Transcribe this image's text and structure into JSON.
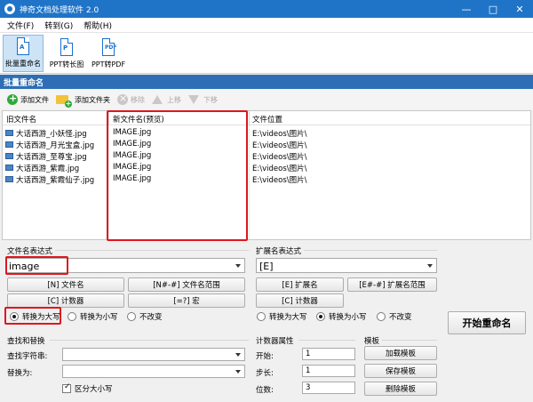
{
  "window": {
    "title": "神奇文档处理软件 2.0"
  },
  "menu": [
    "文件(F)",
    "转到(G)",
    "帮助(H)"
  ],
  "toolbar": {
    "tools": [
      {
        "label": "批量重命名",
        "icon": "rename-icon"
      },
      {
        "label": "PPT转长图",
        "icon": "ppt-icon"
      },
      {
        "label": "PPT转PDF",
        "icon": "pdf-icon"
      }
    ]
  },
  "section_title": "批量重命名",
  "actions": {
    "add_file": "添加文件",
    "add_folder": "添加文件夹",
    "remove": "移除",
    "move_up": "上移",
    "move_down": "下移"
  },
  "table": {
    "headers": {
      "old": "旧文件名",
      "new": "新文件名(预览)",
      "location": "文件位置"
    },
    "rows": [
      {
        "old": "大话西游_小妖怪.jpg",
        "new": "IMAGE.jpg",
        "location": "E:\\videos\\图片\\"
      },
      {
        "old": "大话西游_月光宝盒.jpg",
        "new": "IMAGE.jpg",
        "location": "E:\\videos\\图片\\"
      },
      {
        "old": "大话西游_至尊宝.jpg",
        "new": "IMAGE.jpg",
        "location": "E:\\videos\\图片\\"
      },
      {
        "old": "大话西游_紫霞.jpg",
        "new": "IMAGE.jpg",
        "location": "E:\\videos\\图片\\"
      },
      {
        "old": "大话西游_紫霞仙子.jpg",
        "new": "IMAGE.jpg",
        "location": "E:\\videos\\图片\\"
      }
    ]
  },
  "filename_expr": {
    "label": "文件名表达式",
    "value": "image",
    "buttons": {
      "name": "[N] 文件名",
      "range": "[N#-#] 文件名范围",
      "counter": "[C] 计数器",
      "macro": "[=?] 宏"
    },
    "case": {
      "upper": "转换为大写",
      "lower": "转换为小写",
      "none": "不改变",
      "selected": "upper"
    }
  },
  "ext_expr": {
    "label": "扩展名表达式",
    "value": "[E]",
    "buttons": {
      "ext": "[E] 扩展名",
      "range": "[E#-#] 扩展名范围",
      "counter": "[C] 计数器"
    },
    "case": {
      "upper": "转换为大写",
      "lower": "转换为小写",
      "none": "不改变",
      "selected": "lower"
    }
  },
  "start_button": "开始重命名",
  "find_replace": {
    "label": "查找和替换",
    "find_label": "查找字符串:",
    "replace_label": "替换为:",
    "find_value": "",
    "replace_value": "",
    "case_sensitive": "区分大小写"
  },
  "counter": {
    "label": "计数器属性",
    "start_label": "开始:",
    "start": "1",
    "step_label": "步长:",
    "step": "1",
    "digits_label": "位数:",
    "digits": "3"
  },
  "template": {
    "label": "模板",
    "load": "加载模板",
    "save": "保存模板",
    "delete": "删除模板"
  },
  "colors": {
    "titlebar": "#1f74c8",
    "section": "#2f6eb5",
    "highlight": "#e0161d"
  }
}
